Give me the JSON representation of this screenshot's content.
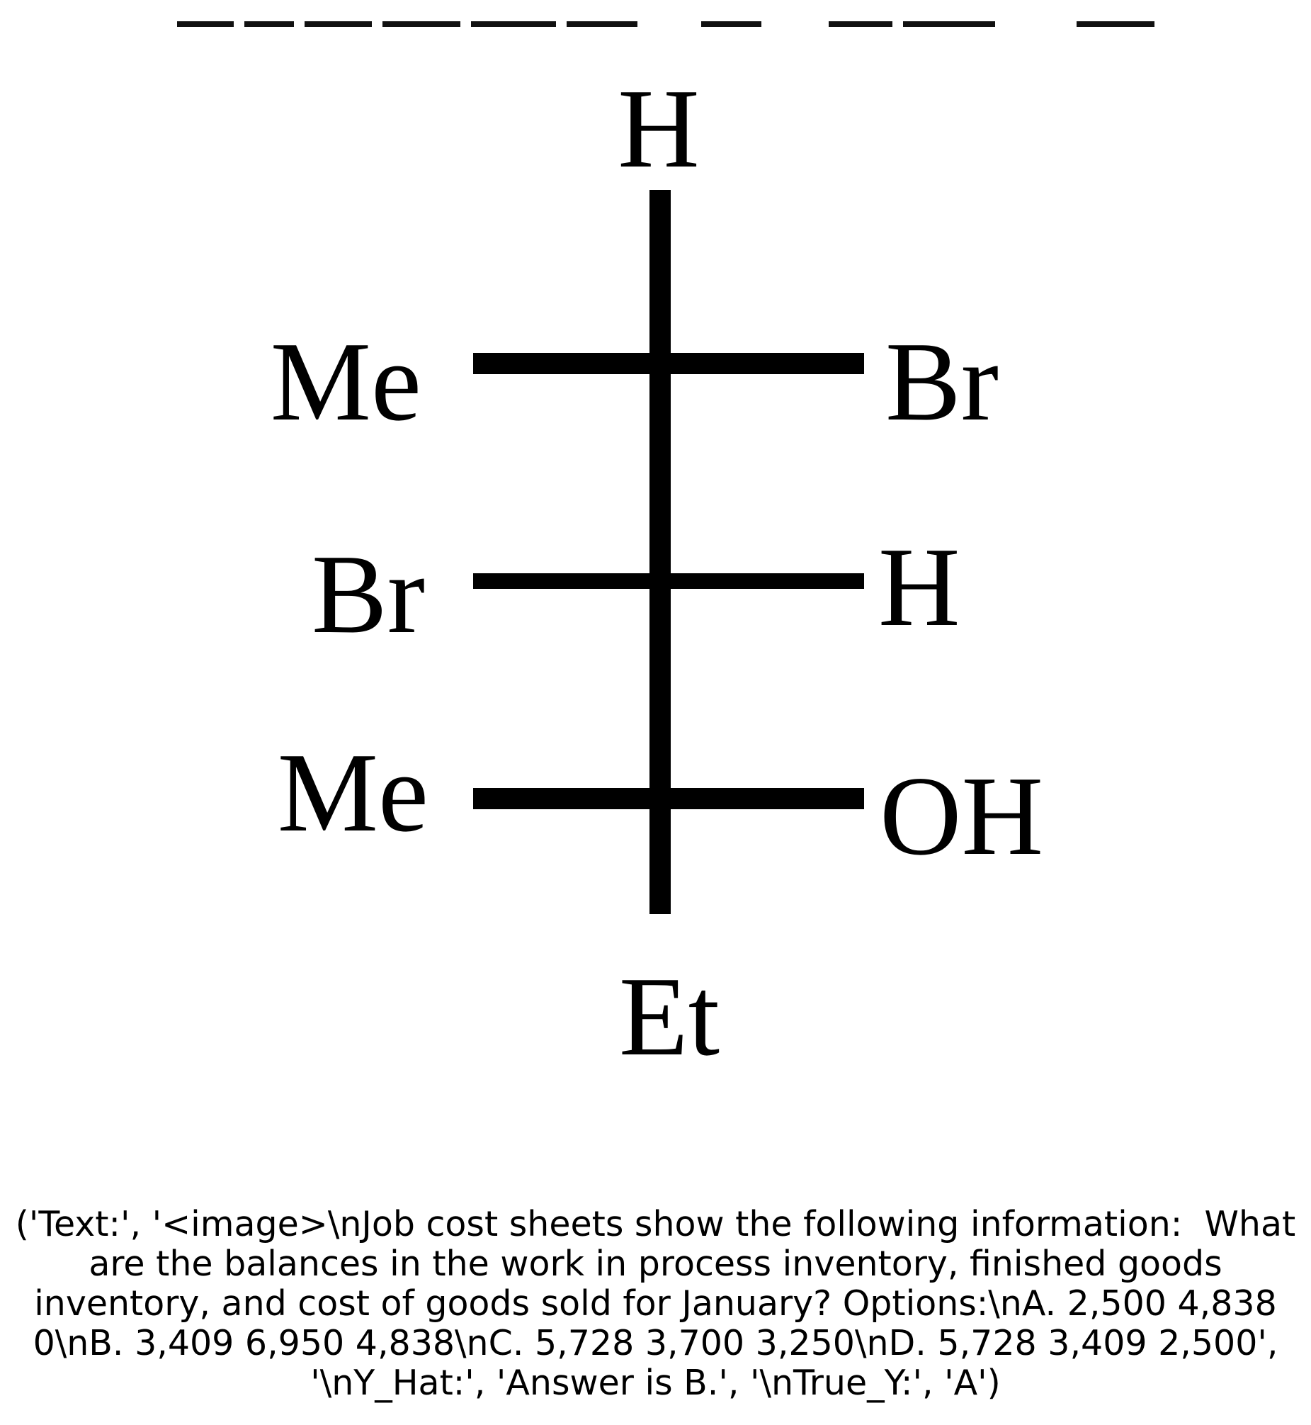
{
  "molecule": {
    "top": "H",
    "bottom": "Et",
    "rows": [
      {
        "left": "Me",
        "right": "Br"
      },
      {
        "left": "Br",
        "right": "H"
      },
      {
        "left": "Me",
        "right": "OH"
      }
    ]
  },
  "caption": {
    "text": "('Text:', '<image>\\nJob cost sheets show the following information:  What are the balances in the work in process inventory, finished goods inventory, and cost of goods sold for January? Options:\\nA. 2,500 4,838 0\\nB. 3,409 6,950 4,838\\nC. 5,728 3,700 3,250\\nD. 5,728 3,409 2,500', '\\nY_Hat:', 'Answer is B.', '\\nTrue_Y:', 'A')"
  }
}
